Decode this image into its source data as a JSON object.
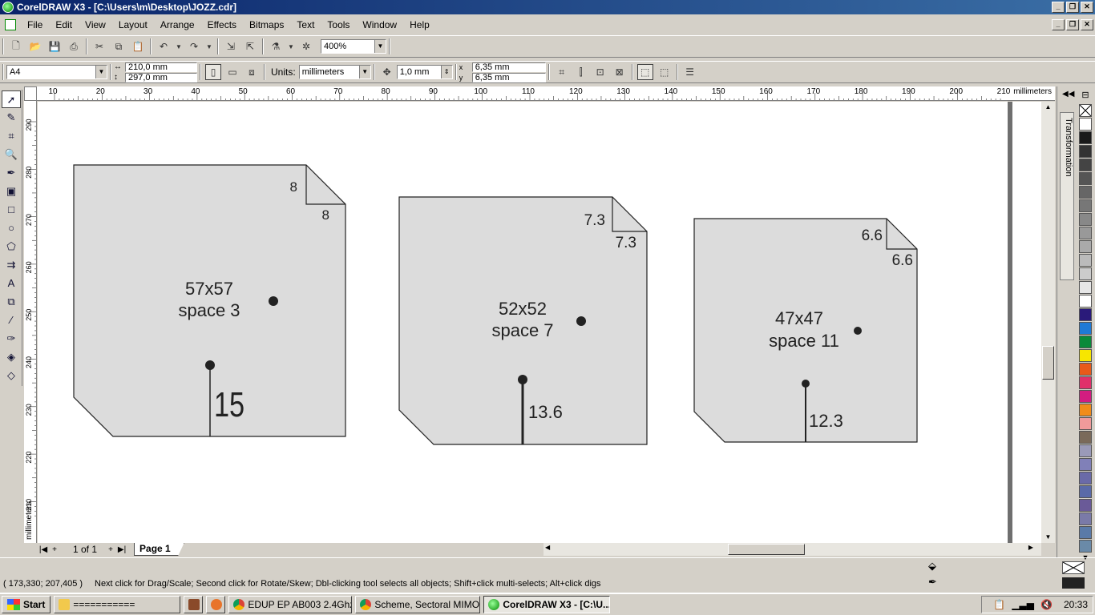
{
  "window": {
    "title": "CorelDRAW X3 - [C:\\Users\\m\\Desktop\\JOZZ.cdr]"
  },
  "menu": [
    "File",
    "Edit",
    "View",
    "Layout",
    "Arrange",
    "Effects",
    "Bitmaps",
    "Text",
    "Tools",
    "Window",
    "Help"
  ],
  "toolbar": {
    "zoom": "400%"
  },
  "property_bar": {
    "paper_size": "A4",
    "width": "210,0 mm",
    "height": "297,0 mm",
    "units_label": "Units:",
    "units": "millimeters",
    "nudge": "1,0 mm",
    "dup_x": "6,35 mm",
    "dup_y": "6,35 mm",
    "dup_x_label": "x",
    "dup_y_label": "y"
  },
  "hruler": {
    "labels": [
      "10",
      "20",
      "30",
      "40",
      "50",
      "60",
      "70",
      "80",
      "90",
      "100",
      "110",
      "120",
      "130",
      "140",
      "150",
      "160",
      "170",
      "180",
      "190",
      "200",
      "210"
    ],
    "unit": "millimeters"
  },
  "vruler": {
    "labels": [
      "290",
      "280",
      "270",
      "260",
      "250",
      "240",
      "230",
      "220",
      "210"
    ],
    "unit": "millimeters"
  },
  "shapes": [
    {
      "corner_top": "8",
      "corner_side": "8",
      "size": "57x57",
      "space": "space 3",
      "stem_value": "15"
    },
    {
      "corner_top": "7.3",
      "corner_side": "7.3",
      "size": "52x52",
      "space": "space 7",
      "stem_value": "13.6"
    },
    {
      "corner_top": "6.6",
      "corner_side": "6.6",
      "size": "47x47",
      "space": "space 11",
      "stem_value": "12.3"
    }
  ],
  "page_nav": {
    "count": "1 of 1",
    "tab": "Page 1"
  },
  "docker": {
    "tab": "Transformation"
  },
  "palette": [
    "#ffffff",
    "#1a1a1a",
    "#333333",
    "#444444",
    "#555555",
    "#666666",
    "#777777",
    "#888888",
    "#999999",
    "#aaaaaa",
    "#bbbbbb",
    "#cccccc",
    "#e6e6e6",
    "#ffffff",
    "#2a1a7a",
    "#1f7ad6",
    "#0a8a3a",
    "#f7e600",
    "#e85a1a",
    "#e0306a",
    "#d21d80",
    "#f08c1a",
    "#f09a9a",
    "#7a6a5a",
    "#9a9ab8",
    "#8080b8",
    "#6a6aa8",
    "#5a6aa8",
    "#6a5a98",
    "#7a7aa8",
    "#5a7aa8",
    "#6a8aa8"
  ],
  "status": {
    "coords": "( 173,330; 207,405 )",
    "hint": "Next click for Drag/Scale; Second click for Rotate/Skew; Dbl-clicking tool selects all objects; Shift+click multi-selects; Alt+click digs"
  },
  "taskbar": {
    "start": "Start",
    "tasks": [
      {
        "label": "===========",
        "color": "#f2c94c"
      },
      {
        "label": "",
        "color": "#8a4a2a"
      },
      {
        "label": "",
        "color": "#e8742a"
      },
      {
        "label": "EDUP EP AB003 2.4Ghz ...",
        "color": "#db4437"
      },
      {
        "label": "Scheme, Sectoral MIMO ...",
        "color": "#db4437"
      },
      {
        "label": "CorelDRAW X3 - [C:\\U...",
        "color": "#2a9a2a"
      }
    ],
    "clock": "20:33"
  }
}
